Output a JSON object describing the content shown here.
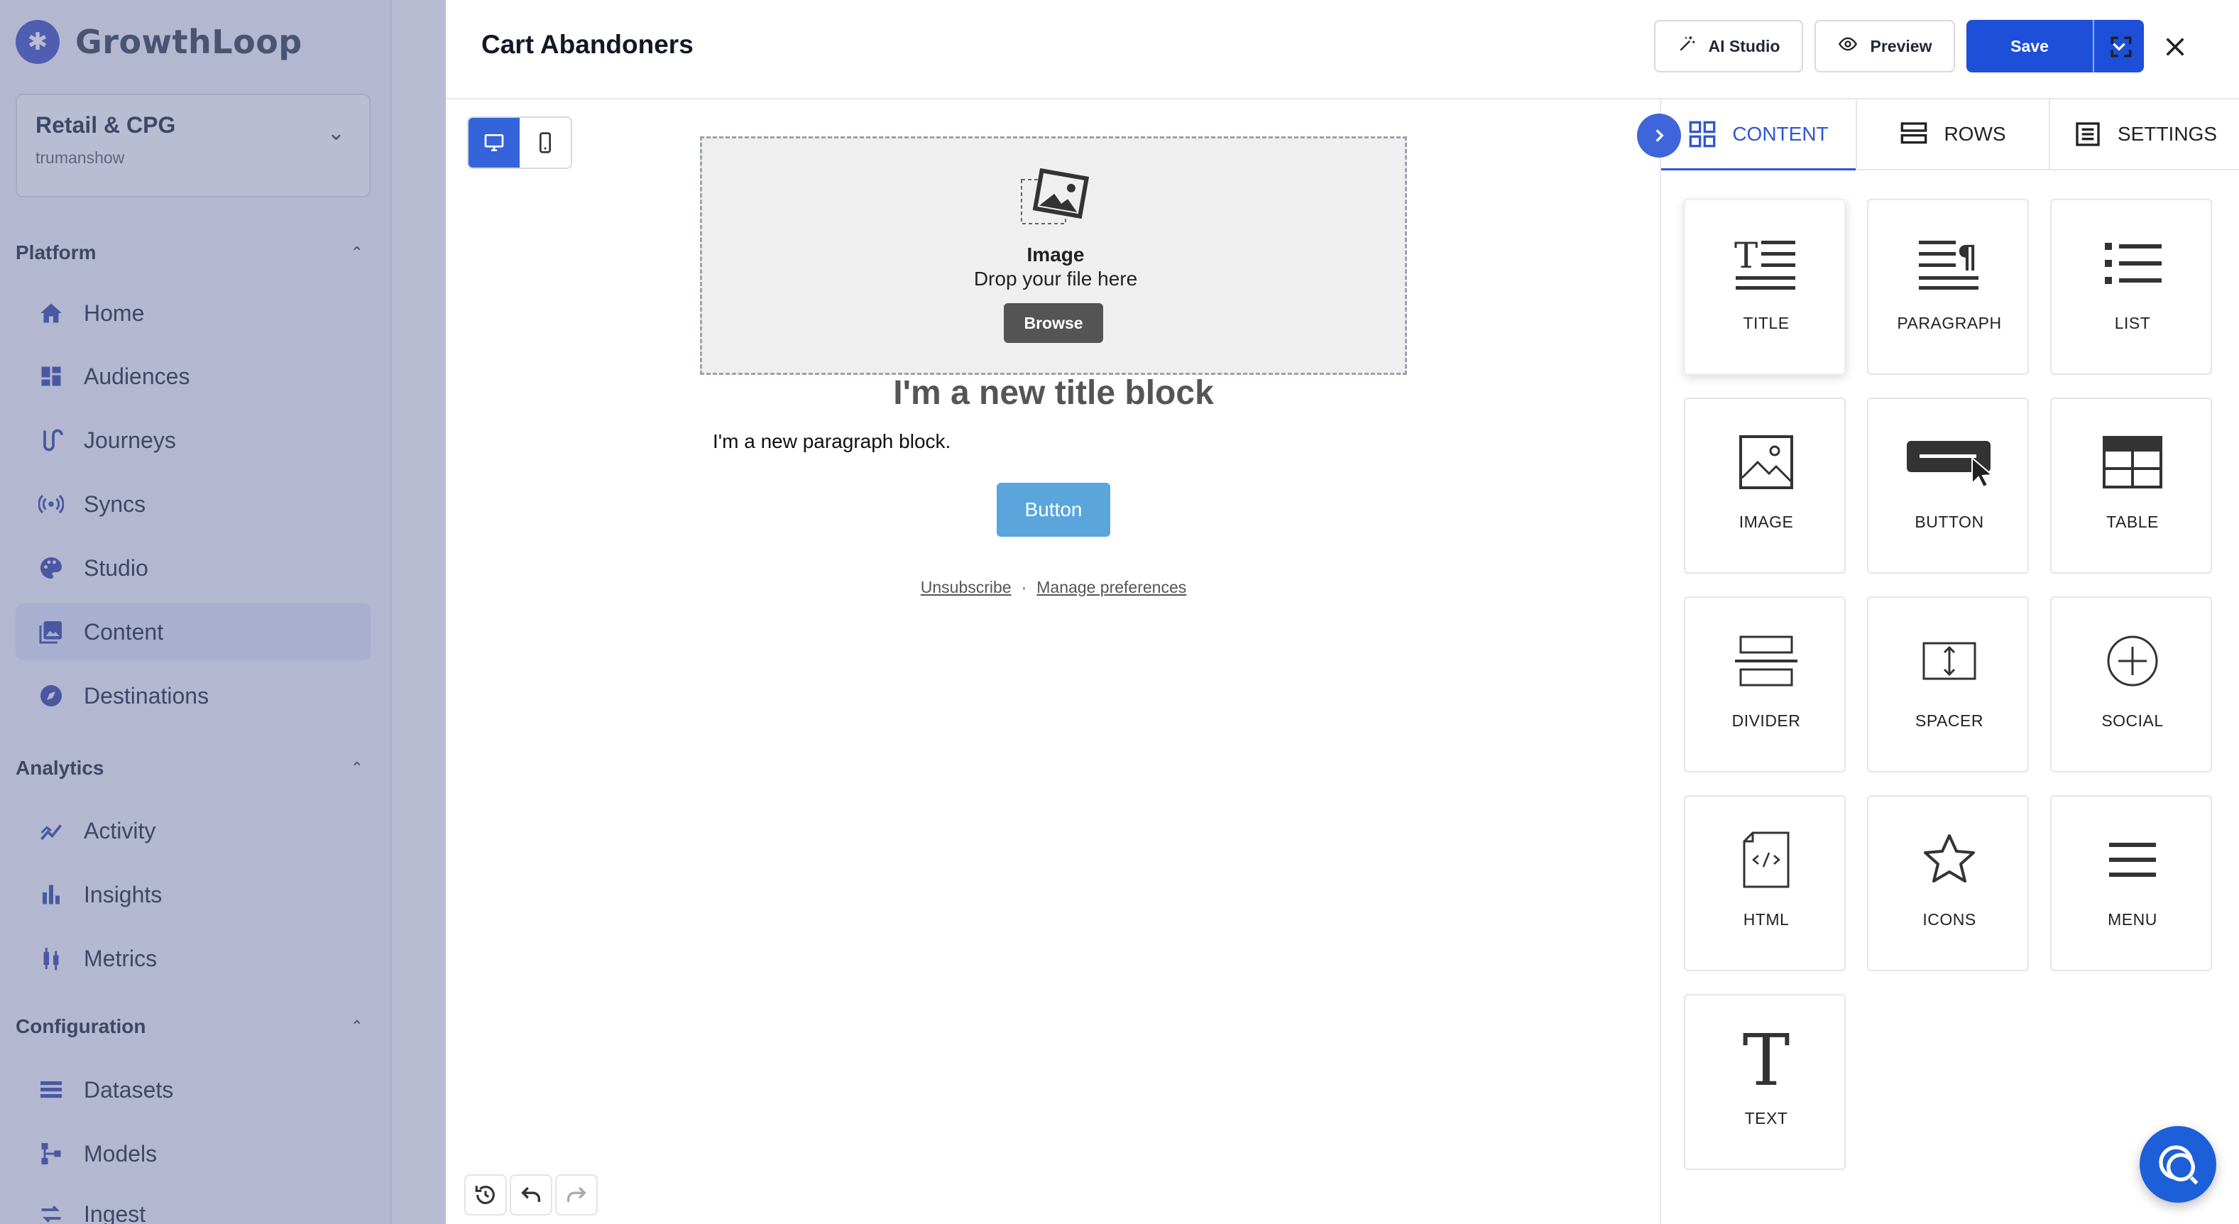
{
  "sidebar": {
    "brand": "GrowthLoop",
    "org": {
      "name": "Retail & CPG",
      "user": "trumanshow"
    },
    "sections": [
      {
        "label": "Platform",
        "items": [
          {
            "label": "Home",
            "icon": "home-icon"
          },
          {
            "label": "Audiences",
            "icon": "dashboard-icon"
          },
          {
            "label": "Journeys",
            "icon": "journey-icon"
          },
          {
            "label": "Syncs",
            "icon": "broadcast-icon"
          },
          {
            "label": "Studio",
            "icon": "palette-icon"
          },
          {
            "label": "Content",
            "icon": "image-gallery-icon",
            "active": true
          },
          {
            "label": "Destinations",
            "icon": "compass-icon"
          }
        ]
      },
      {
        "label": "Analytics",
        "items": [
          {
            "label": "Activity",
            "icon": "activity-icon"
          },
          {
            "label": "Insights",
            "icon": "bar-chart-icon"
          },
          {
            "label": "Metrics",
            "icon": "candlestick-icon"
          }
        ]
      },
      {
        "label": "Configuration",
        "items": [
          {
            "label": "Datasets",
            "icon": "list-icon"
          },
          {
            "label": "Models",
            "icon": "model-tree-icon"
          },
          {
            "label": "Ingest",
            "icon": "ingest-icon"
          }
        ]
      }
    ]
  },
  "editor": {
    "title": "Cart Abandoners",
    "ai_studio_label": "AI Studio",
    "preview_label": "Preview",
    "save_label": "Save",
    "canvas": {
      "image_title": "Image",
      "image_subtitle": "Drop your file here",
      "browse_label": "Browse",
      "title_block": "I'm a new title block",
      "paragraph_block": "I'm a new paragraph block.",
      "button_label": "Button",
      "unsubscribe_label": "Unsubscribe",
      "separator": "·",
      "manage_label": "Manage preferences"
    },
    "panel": {
      "tabs": [
        {
          "label": "CONTENT",
          "icon": "grid-icon",
          "active": true
        },
        {
          "label": "ROWS",
          "icon": "rows-icon"
        },
        {
          "label": "SETTINGS",
          "icon": "settings-doc-icon"
        }
      ],
      "blocks": [
        {
          "label": "TITLE",
          "icon": "title-icon"
        },
        {
          "label": "PARAGRAPH",
          "icon": "paragraph-icon"
        },
        {
          "label": "LIST",
          "icon": "list-icon"
        },
        {
          "label": "IMAGE",
          "icon": "image-icon"
        },
        {
          "label": "BUTTON",
          "icon": "button-icon"
        },
        {
          "label": "TABLE",
          "icon": "table-icon"
        },
        {
          "label": "DIVIDER",
          "icon": "divider-icon"
        },
        {
          "label": "SPACER",
          "icon": "spacer-icon"
        },
        {
          "label": "SOCIAL",
          "icon": "social-icon"
        },
        {
          "label": "HTML",
          "icon": "html-icon"
        },
        {
          "label": "ICONS",
          "icon": "star-icon"
        },
        {
          "label": "MENU",
          "icon": "menu-icon"
        },
        {
          "label": "TEXT",
          "icon": "text-icon"
        }
      ]
    }
  },
  "colors": {
    "primary": "#1d4fd8",
    "accent_tab": "#2f57d1",
    "email_button": "#5aa6dc",
    "overlay": "#46528c"
  }
}
